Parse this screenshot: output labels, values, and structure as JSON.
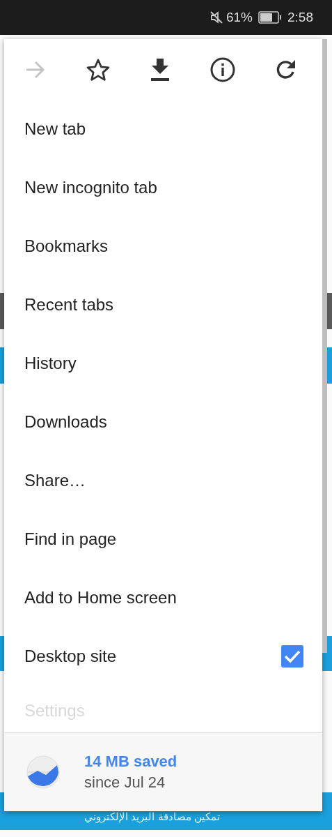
{
  "status_bar": {
    "battery_percent": "61%",
    "time": "2:58",
    "muted": true
  },
  "toolbar": [
    {
      "kind": "forward",
      "disabled": true
    },
    {
      "kind": "bookmark",
      "disabled": false
    },
    {
      "kind": "download",
      "disabled": false
    },
    {
      "kind": "info",
      "disabled": false
    },
    {
      "kind": "refresh",
      "disabled": false
    }
  ],
  "menu_items": [
    {
      "label": "New tab",
      "kind": "plain"
    },
    {
      "label": "New incognito tab",
      "kind": "plain"
    },
    {
      "label": "Bookmarks",
      "kind": "plain"
    },
    {
      "label": "Recent tabs",
      "kind": "plain"
    },
    {
      "label": "History",
      "kind": "plain"
    },
    {
      "label": "Downloads",
      "kind": "plain"
    },
    {
      "label": "Share…",
      "kind": "plain"
    },
    {
      "label": "Find in page",
      "kind": "plain"
    },
    {
      "label": "Add to Home screen",
      "kind": "plain"
    },
    {
      "label": "Desktop site",
      "kind": "checkbox",
      "checked": true
    },
    {
      "label": "Settings",
      "kind": "faded"
    }
  ],
  "data_saver": {
    "title": "14 MB saved",
    "subtitle": "since Jul 24"
  },
  "page_banner": {
    "text": "تمكين مصادقة البريد الإلكتروني"
  }
}
